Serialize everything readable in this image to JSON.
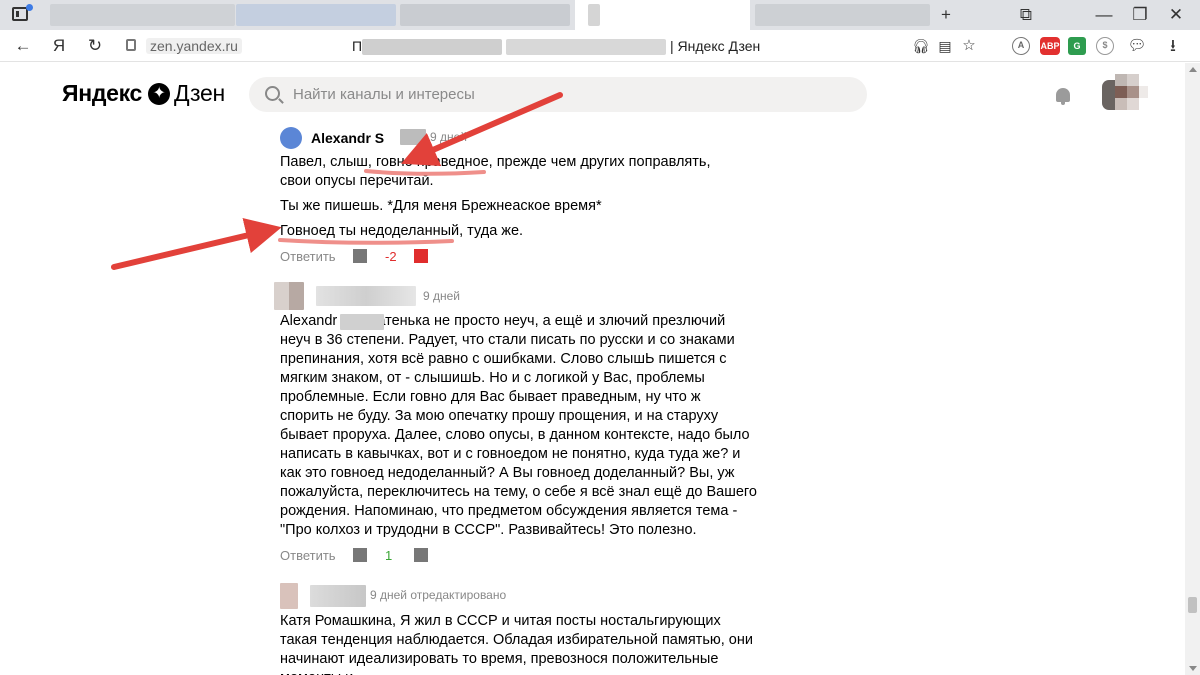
{
  "browser": {
    "url": "zen.yandex.ru",
    "page_title": "| Яндекс Дзен",
    "title_prefix": "П",
    "yandex_button": "Я",
    "tab_controls": {
      "new_tab": "+"
    },
    "window_controls": {
      "minimize": "—",
      "restore": "❐",
      "close": "✕"
    },
    "extensions": [
      {
        "name": "adblock",
        "label": "ABP",
        "color": "#e2302f"
      },
      {
        "name": "translate",
        "label": "G",
        "color": "#2e9c4f"
      }
    ]
  },
  "header": {
    "logo_main": "Яндекс",
    "logo_sub": "Дзен",
    "search_placeholder": "Найти каналы и интересы"
  },
  "comments": [
    {
      "author": "Alexandr S",
      "time": "9 дней",
      "paragraphs": [
        "Павел, слыш, говно праведное, прежде чем других поправлять, свои опусы перечитай.",
        "Ты же пишешь. *Для меня Брежнеаское время*",
        "Говноед ты недоделанный, туда же."
      ],
      "reply": "Ответить",
      "score": "-2",
      "score_color": "#e02d2d"
    },
    {
      "author": "",
      "time": "9 дней",
      "paragraphs": [
        "Alexandr        Вы, батенька не просто неуч, а ещё и злючий презлючий неуч в 36 степени. Радует, что стали писать по русски и со знаками препинания, хотя всё равно с ошибками. Слово слышЬ пишется с мягким знаком, от - слышишЬ. Но и с логикой у Вас, проблемы проблемные. Если говно для Вас бывает праведным, ну что ж спорить не буду. За мою опечатку прошу прощения, и на старуху бывает проруха. Далее, слово опусы, в данном контексте, надо было написать в кавычках, вот и с говноедом не понятно, куда туда же? и как это говноед недоделанный? А Вы говноед доделанный? Вы, уж пожалуйста, переключитесь на тему, о себе я всё знал ещё до Вашего рождения. Напоминаю, что предметом обсуждения является тема - \"Про колхоз и трудодни в СССР\". Развивайтесь! Это полезно."
      ],
      "reply": "Ответить",
      "score": "1",
      "score_color": "#3aa635"
    },
    {
      "author": "",
      "time": "9 дней  отредактировано",
      "paragraphs": [
        "Катя Ромашкина, Я жил в СССР и читая посты ностальгирующих такая тенденция наблюдается. Обладая избирательной памятью, они начинают идеализировать то время, превознося положительные моменты и"
      ]
    }
  ],
  "annotations": {
    "arrow_color": "#e2413a",
    "underline_color": "#ef8f8a"
  }
}
